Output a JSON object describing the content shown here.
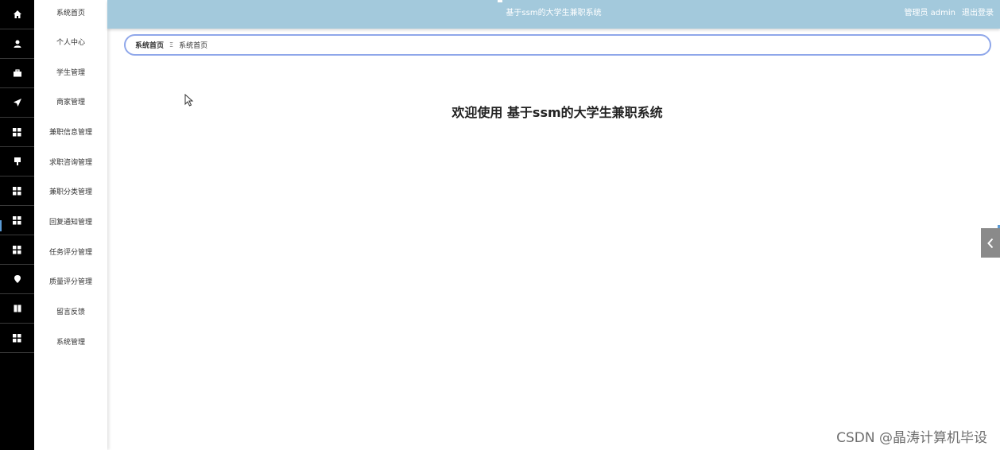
{
  "header": {
    "title": "基于ssm的大学生兼职系统",
    "user_label": "管理员 admin",
    "logout_label": "退出登录"
  },
  "sidebar": {
    "items": [
      {
        "label": "系统首页",
        "icon": "home-icon"
      },
      {
        "label": "个人中心",
        "icon": "user-icon"
      },
      {
        "label": "学生管理",
        "icon": "briefcase-icon"
      },
      {
        "label": "商家管理",
        "icon": "send-icon"
      },
      {
        "label": "兼职信息管理",
        "icon": "grid-icon"
      },
      {
        "label": "求职咨询管理",
        "icon": "sign-icon"
      },
      {
        "label": "兼职分类管理",
        "icon": "grid-icon"
      },
      {
        "label": "回复通知管理",
        "icon": "grid-icon"
      },
      {
        "label": "任务评分管理",
        "icon": "grid-icon"
      },
      {
        "label": "质量评分管理",
        "icon": "map-pin-icon"
      },
      {
        "label": "留言反馈",
        "icon": "book-icon"
      },
      {
        "label": "系统管理",
        "icon": "grid-icon"
      }
    ]
  },
  "breadcrumb": {
    "first": "系统首页",
    "separator": "Ξ",
    "second": "系统首页"
  },
  "main": {
    "welcome": "欢迎使用 基于ssm的大学生兼职系统"
  },
  "watermark": "CSDN @晶涛计算机毕设"
}
